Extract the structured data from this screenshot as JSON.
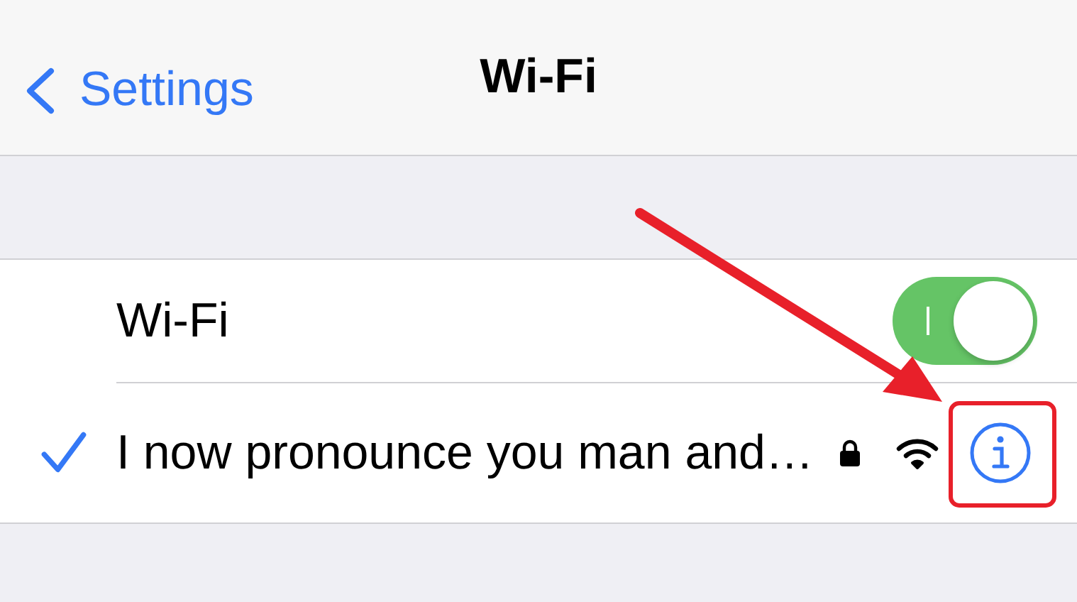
{
  "nav_bar": {
    "back_label": "Settings",
    "title": "Wi-Fi"
  },
  "wifi_row": {
    "label": "Wi-Fi",
    "on": true
  },
  "networks": [
    {
      "name": "I now pronounce you man and…",
      "selected": true,
      "secured": true
    }
  ]
}
